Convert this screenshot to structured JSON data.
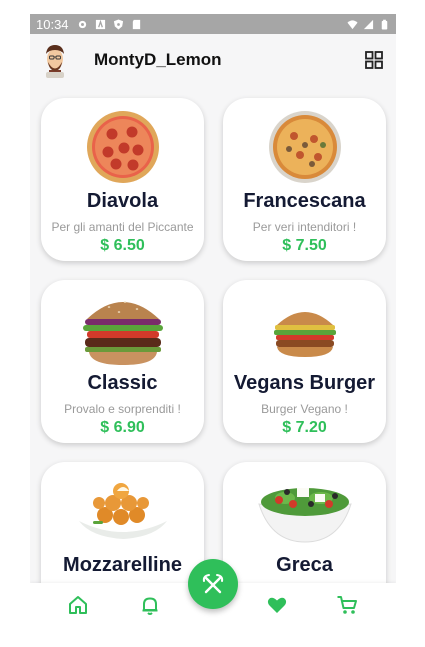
{
  "status_bar": {
    "time": "10:34",
    "icons": [
      "settings-icon",
      "a-box-icon",
      "shield-icon",
      "sdcard-icon"
    ],
    "right_icons": [
      "wifi-icon",
      "signal-icon",
      "battery-icon"
    ]
  },
  "header": {
    "username": "MontyD_Lemon",
    "avatar_icon": "avatar-icon",
    "grid_icon": "grid-view-icon"
  },
  "products": [
    {
      "name": "Diavola",
      "description": "Per gli amanti del Piccante",
      "price": "$ 6.50",
      "image": "pizza-diavola"
    },
    {
      "name": "Francescana",
      "description": "Per veri intenditori !",
      "price": "$ 7.50",
      "image": "pizza-francescana"
    },
    {
      "name": "Classic",
      "description": "Provalo e sorprenditi !",
      "price": "$ 6.90",
      "image": "burger-classic"
    },
    {
      "name": "Vegans Burger",
      "description": "Burger Vegano !",
      "price": "$ 7.20",
      "image": "burger-vegan"
    },
    {
      "name": "Mozzarelline",
      "description": "",
      "price": "",
      "image": "fried-mozzarella"
    },
    {
      "name": "Greca",
      "description": "",
      "price": "",
      "image": "greek-salad"
    }
  ],
  "bottom_nav": {
    "items": [
      "home-icon",
      "bell-icon",
      "heart-icon",
      "cart-icon"
    ],
    "fab": "fork-knife-icon"
  },
  "colors": {
    "accent": "#2fbf5a",
    "title": "#141a33",
    "description": "#9a9a9a",
    "status_bar": "#a6a6a6"
  }
}
